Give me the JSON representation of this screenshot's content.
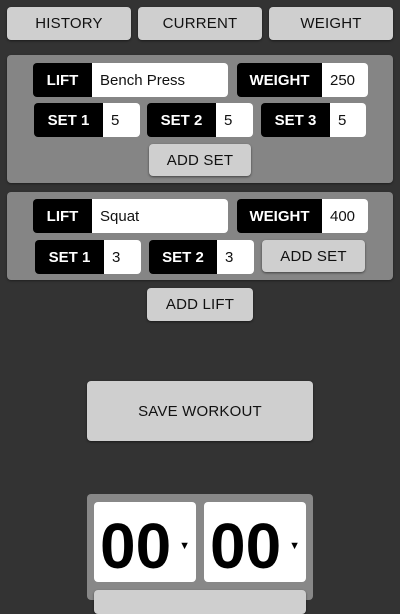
{
  "tabs": [
    "HISTORY",
    "CURRENT",
    "WEIGHT"
  ],
  "lifts": [
    {
      "lift_label": "LIFT",
      "lift_value": "Bench Press",
      "weight_label": "WEIGHT",
      "weight_value": "250",
      "sets": [
        {
          "label": "SET 1",
          "value": "5"
        },
        {
          "label": "SET 2",
          "value": "5"
        },
        {
          "label": "SET 3",
          "value": "5"
        }
      ],
      "add_set_label": "ADD SET"
    },
    {
      "lift_label": "LIFT",
      "lift_value": "Squat",
      "weight_label": "WEIGHT",
      "weight_value": "400",
      "sets": [
        {
          "label": "SET 1",
          "value": "3"
        },
        {
          "label": "SET 2",
          "value": "3"
        }
      ],
      "add_set_label": "ADD SET"
    }
  ],
  "add_lift_label": "ADD LIFT",
  "save_workout_label": "SAVE WORKOUT",
  "timer": {
    "minutes": "00",
    "seconds": "00",
    "caret": "▼"
  },
  "colors": {
    "background": "#333333",
    "panel": "#858585",
    "button": "#cfcfcf",
    "label_bg": "#000000",
    "value_bg": "#ffffff"
  }
}
